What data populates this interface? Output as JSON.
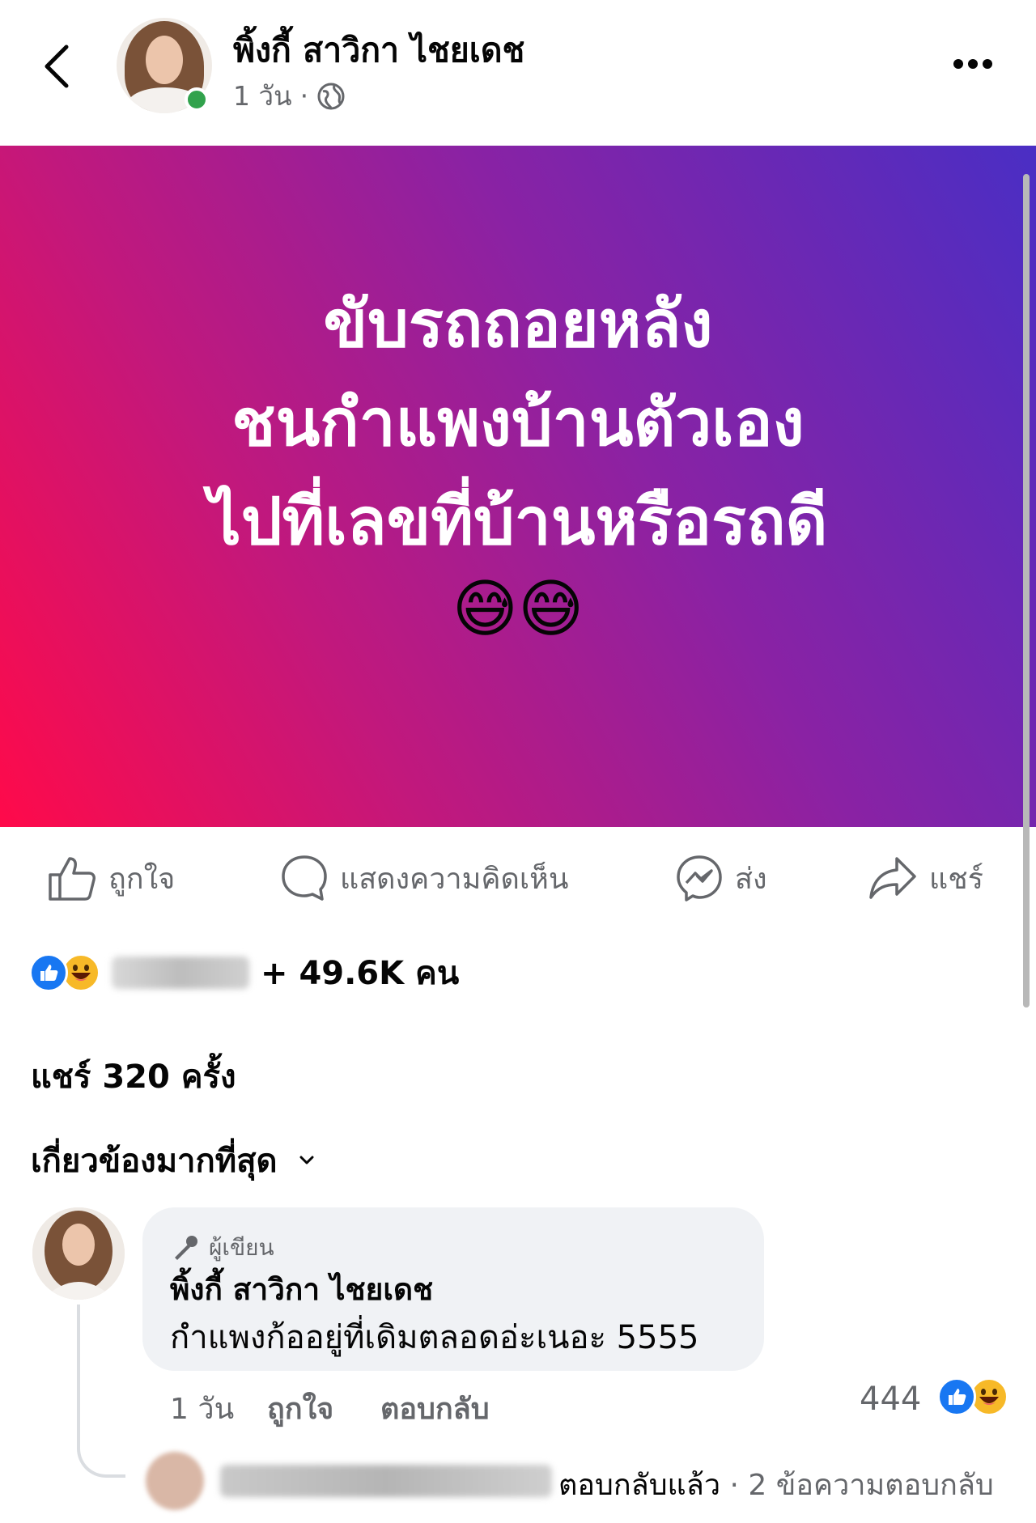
{
  "header": {
    "author_name": "พิ้งกี้ สาวิกา ไชยเดช",
    "post_time": "1 วัน",
    "meta_separator": "·",
    "privacy_icon": "globe-icon",
    "back_icon": "chevron-left-icon",
    "more_icon": "more-horizontal-icon",
    "online_status_color": "#31a24c"
  },
  "post": {
    "lines": [
      "ขับรถถอยหลัง",
      "ชนกำแพงบ้านตัวเอง",
      "ไปที่เลขที่บ้านหรือรถดี"
    ],
    "emojis": "😅😅",
    "gradient_colors": [
      "#ff0a4a",
      "#c2187c",
      "#8a22a4",
      "#4a2ec4"
    ]
  },
  "actions": {
    "like_label": "ถูกใจ",
    "comment_label": "แสดงความคิดเห็น",
    "send_label": "ส่ง",
    "share_label": "แชร์"
  },
  "reactions": {
    "icons": [
      "like-reaction-icon",
      "haha-reaction-icon"
    ],
    "count_text": "+ 49.6K คน",
    "like_color": "#1877f2"
  },
  "share_count": "แชร์ 320 ครั้ง",
  "sort": {
    "label": "เกี่ยวข้องมากที่สุด"
  },
  "comment": {
    "badge_label": "ผู้เขียน",
    "author": "พิ้งกี้ สาวิกา ไชยเดช",
    "text": "กำแพงก้ออยู่ที่เดิมตลอดอ่ะเนอะ 5555",
    "time": "1 วัน",
    "like_label": "ถูกใจ",
    "reply_label": "ตอบกลับ",
    "reaction_count": "444"
  },
  "reply_summary": {
    "replied": "ตอบกลับแล้ว",
    "separator": "·",
    "count_text": "2 ข้อความตอบกลับ"
  }
}
